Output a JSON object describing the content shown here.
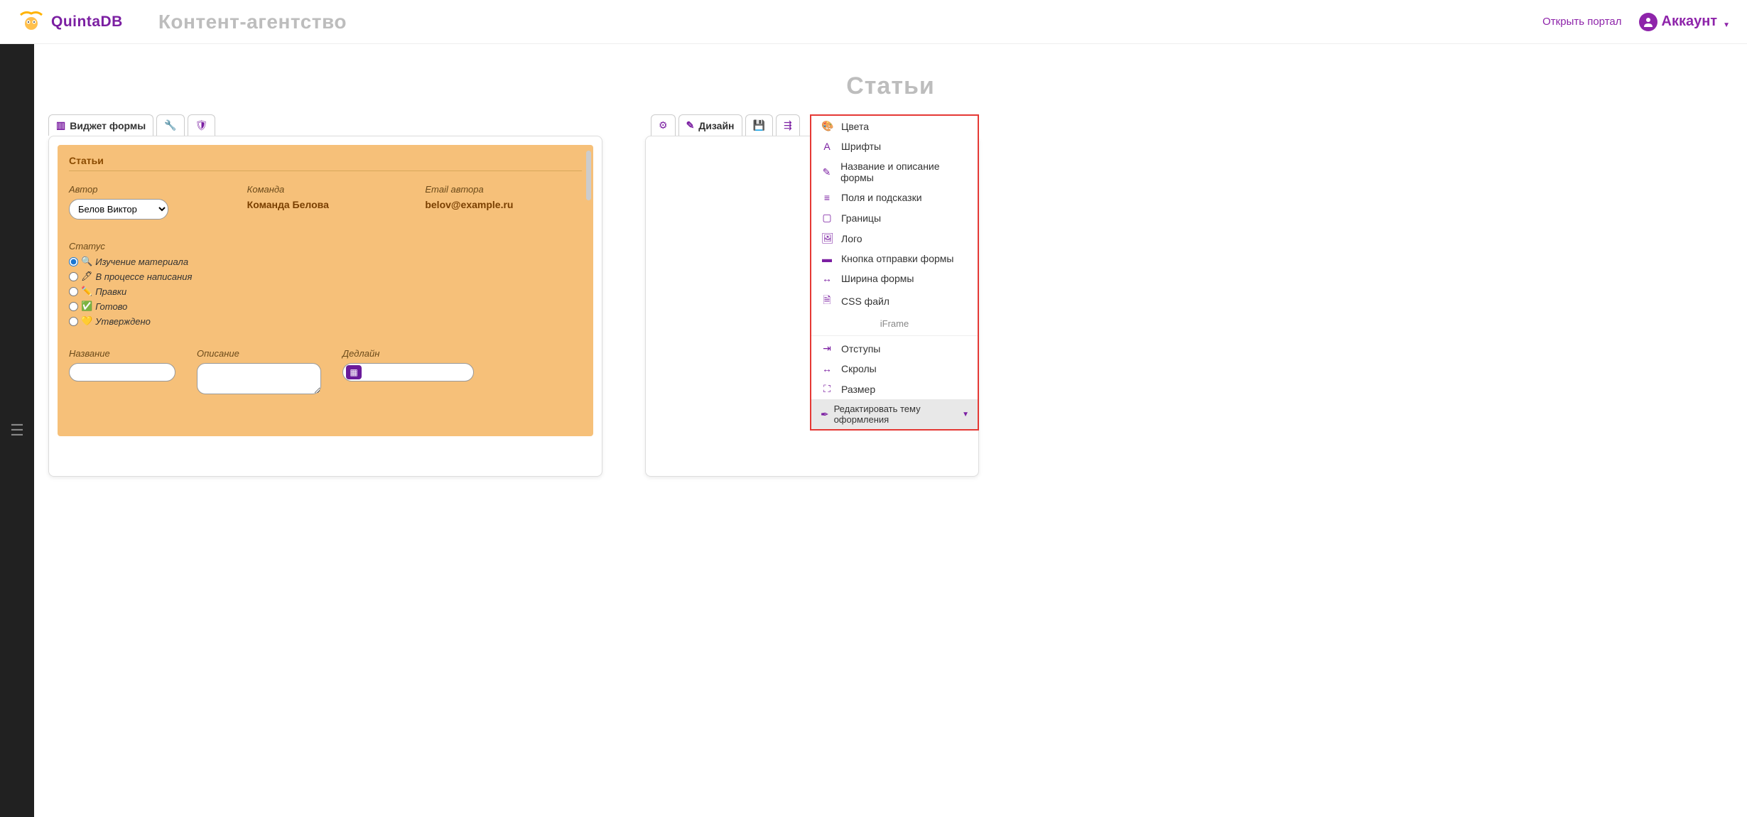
{
  "header": {
    "brand": "QuintaDB",
    "app_title": "Контент-агентство",
    "open_portal": "Открыть портал",
    "account": "Аккаунт"
  },
  "page_title": "Статьи",
  "left_tabs": {
    "widget": "Виджет формы"
  },
  "form": {
    "title": "Статьи",
    "author_label": "Автор",
    "author_value": "Белов Виктор",
    "team_label": "Команда",
    "team_value": "Команда Белова",
    "email_label": "Email автора",
    "email_value": "belov@example.ru",
    "status_label": "Статус",
    "status_options": {
      "s1": "Изучение материала",
      "s2": "В процессе написания",
      "s3": "Правки",
      "s4": "Готово",
      "s5": "Утверждено"
    },
    "name_label": "Название",
    "desc_label": "Описание",
    "deadline_label": "Дедлайн"
  },
  "right_tabs": {
    "design": "Дизайн"
  },
  "design_menu": {
    "colors": "Цвета",
    "fonts": "Шрифты",
    "title_desc": "Название и описание формы",
    "fields": "Поля и подсказки",
    "borders": "Границы",
    "logo": "Лого",
    "submit_btn": "Кнопка отправки формы",
    "width": "Ширина формы",
    "css": "CSS файл",
    "iframe": "iFrame",
    "padding": "Отступы",
    "scrolls": "Скролы",
    "size": "Размер",
    "edit_theme": "Редактировать тему оформления"
  }
}
